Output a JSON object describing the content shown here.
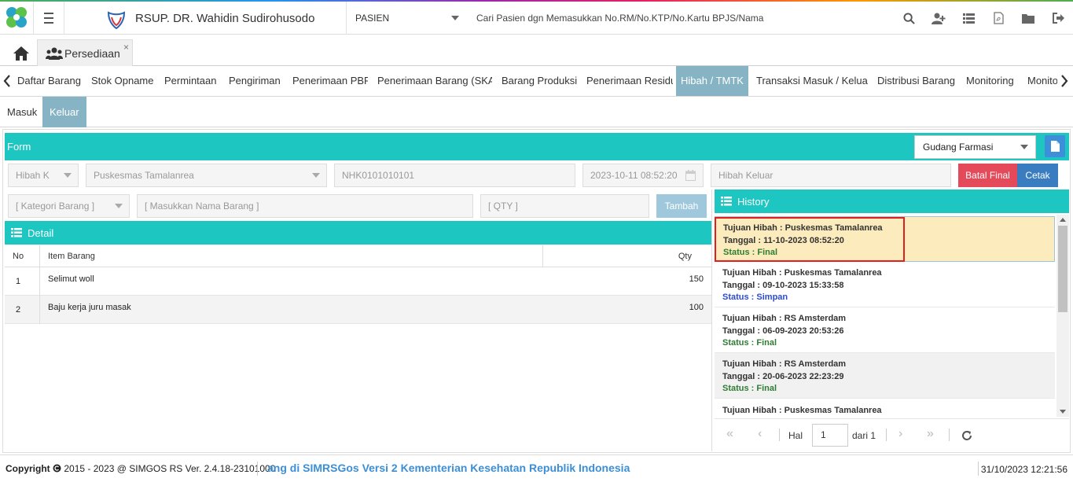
{
  "header": {
    "hospital_name": "RSUP. DR. Wahidin Sudirohusodo",
    "patient_select": "PASIEN",
    "search_placeholder": "Cari Pasien dgn Memasukkan No.RM/No.KTP/No.Kartu BPJS/Nama",
    "icons": [
      "search-icon",
      "add-user-icon",
      "list-icon",
      "pdf-icon",
      "folder-icon",
      "logout-icon"
    ]
  },
  "tabs": {
    "page_tab": "Persediaan",
    "close": "×"
  },
  "menu": {
    "items": [
      "Daftar Barang",
      "Stok Opname",
      "Permintaan",
      "Pengiriman",
      "Penerimaan PBF",
      "Penerimaan Barang (SKA)",
      "Barang Produksi",
      "Penerimaan Residu",
      "Hibah / TMTK",
      "Transaksi Masuk / Keluar",
      "Distribusi Barang",
      "Monitoring",
      "Monitoring"
    ],
    "active": "Hibah / TMTK"
  },
  "subtabs": {
    "items": [
      "Masuk",
      "Keluar"
    ],
    "active": "Keluar"
  },
  "form": {
    "title": "Form",
    "gudang": "Gudang Farmasi",
    "jenis": "Hibah K",
    "tujuan": "Puskesmas Tamalanrea",
    "nomor": "NHK0101010101",
    "tanggal": "2023-10-11 08:52:20",
    "keterangan_placeholder": "Hibah Keluar",
    "batal_final_label": "Batal Final",
    "cetak_label": "Cetak",
    "kategori_placeholder": "[ Kategori Barang ]",
    "nama_barang_placeholder": "[ Masukkan Nama Barang ]",
    "qty_placeholder": "[ QTY ]",
    "tambah_label": "Tambah"
  },
  "detail": {
    "title": "Detail",
    "columns": [
      "No",
      "Item Barang",
      "Qty"
    ],
    "rows": [
      {
        "no": "1",
        "item": "Selimut woll",
        "qty": "150"
      },
      {
        "no": "2",
        "item": "Baju kerja juru masak",
        "qty": "100"
      }
    ]
  },
  "history": {
    "title": "History",
    "items": [
      {
        "tujuan": "Tujuan Hibah : Puskesmas Tamalanrea",
        "tanggal": "Tanggal : 11-10-2023 08:52:20",
        "status": "Status : Final",
        "status_type": "final"
      },
      {
        "tujuan": "Tujuan Hibah : Puskesmas Tamalanrea",
        "tanggal": "Tanggal : 09-10-2023 15:33:58",
        "status": "Status : Simpan",
        "status_type": "simpan"
      },
      {
        "tujuan": "Tujuan Hibah : RS Amsterdam",
        "tanggal": "Tanggal : 06-09-2023 20:53:26",
        "status": "Status : Final",
        "status_type": "final"
      },
      {
        "tujuan": "Tujuan Hibah : RS Amsterdam",
        "tanggal": "Tanggal : 20-06-2023 22:23:29",
        "status": "Status : Final",
        "status_type": "final"
      },
      {
        "tujuan": "Tujuan Hibah : Puskesmas Tamalanrea",
        "tanggal": "",
        "status": "",
        "status_type": "final"
      }
    ],
    "pager": {
      "hal_label": "Hal",
      "page": "1",
      "total_label": "dari 1"
    }
  },
  "footer": {
    "copyright_label": "Copyright",
    "copyright_text": "2015 - 2023 @ SIMGOS RS Ver. 2.4.18-23101000",
    "marquee": "ang di SIMRSGos Versi 2 Kementerian Kesehatan Republik Indonesia",
    "datetime": "31/10/2023 12:21:56"
  },
  "colors": {
    "teal": "#1ec6c1",
    "active_tab": "#87b4c4",
    "batal_final": "#e44a5a",
    "cetak": "#3a7cc0",
    "tambah": "#9fc8dc",
    "highlight": "#e11f1f"
  }
}
